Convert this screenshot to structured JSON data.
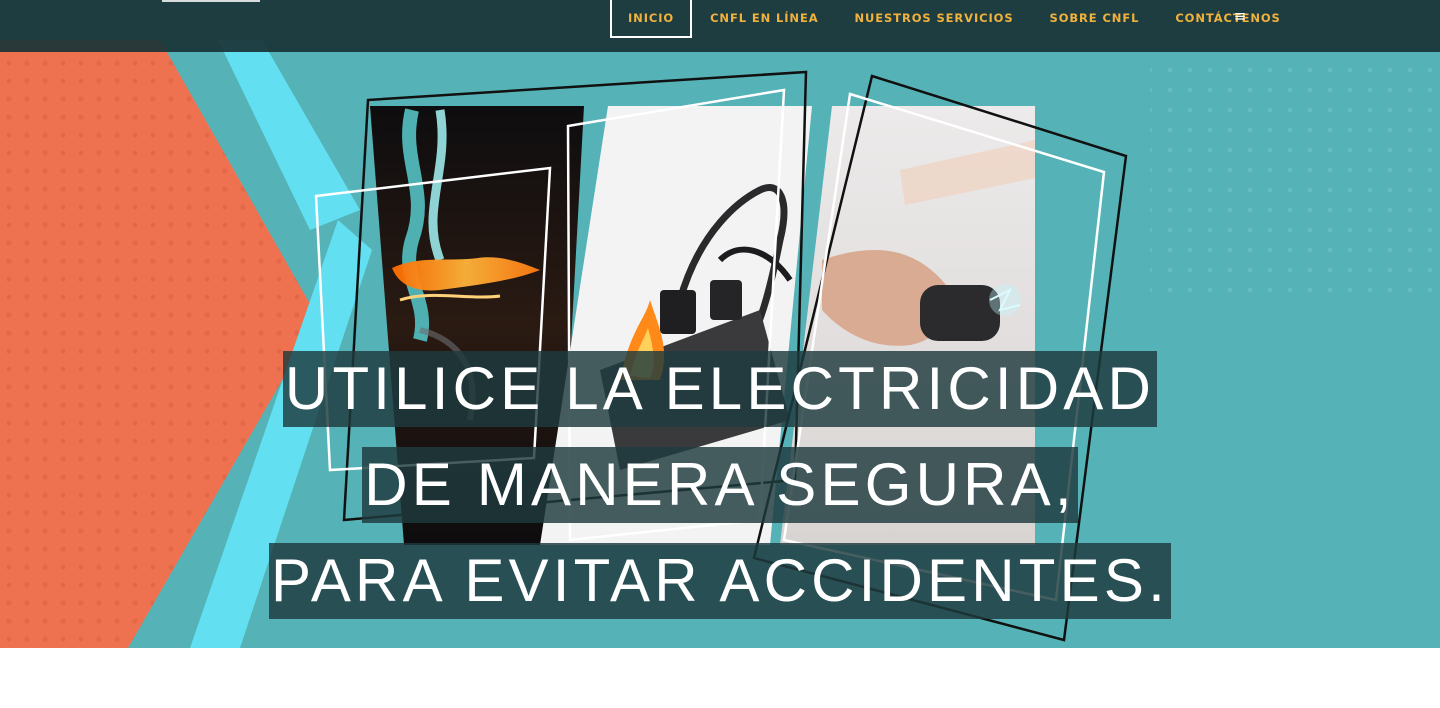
{
  "nav": {
    "items": [
      "INICIO",
      "CNFL EN LÍNEA",
      "NUESTROS SERVICIOS",
      "SOBRE CNFL",
      "CONTÁCTENOS"
    ],
    "active": "INICIO",
    "menu_icon": "hamburger-icon",
    "menu_glyph": "≡"
  },
  "hero": {
    "lines": [
      "UTILICE LA ELECTRICIDAD",
      "DE MANERA SEGURA,",
      "PARA EVITAR ACCIDENTES."
    ],
    "images": [
      "burning-cable-photo",
      "burning-power-strip-photo",
      "plug-sparking-outlet-photo"
    ]
  },
  "colors": {
    "nav_bg": "#1a3438",
    "nav_text": "#f0b23c",
    "teal": "#55b3b8",
    "orange": "#ee7250",
    "cyan_stripe": "#62e0f2",
    "headline_bg": "#1e3a3e"
  }
}
